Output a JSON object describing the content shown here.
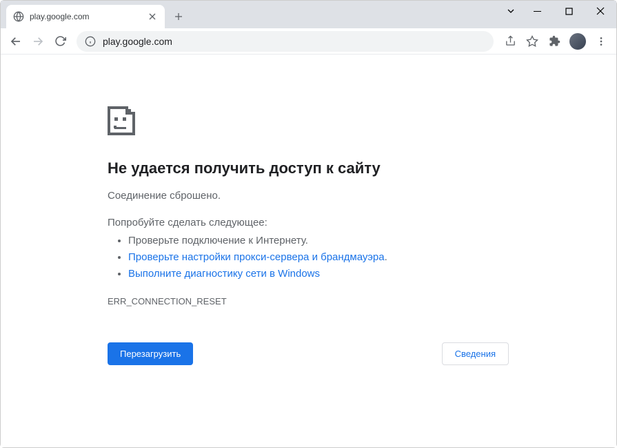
{
  "tab": {
    "title": "play.google.com"
  },
  "omnibox": {
    "url": "play.google.com"
  },
  "error": {
    "heading": "Не удается получить доступ к сайту",
    "subtitle": "Соединение сброшено.",
    "try_label": "Попробуйте сделать следующее:",
    "suggestions": {
      "item1": "Проверьте подключение к Интернету.",
      "item2": "Проверьте настройки прокси-сервера и брандмауэра",
      "item2_suffix": ".",
      "item3": "Выполните диагностику сети в Windows"
    },
    "code": "ERR_CONNECTION_RESET",
    "reload_label": "Перезагрузить",
    "details_label": "Сведения"
  }
}
